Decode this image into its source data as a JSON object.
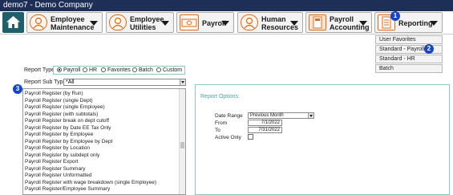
{
  "window": {
    "title": "demo7 - Demo Company"
  },
  "toolbar": {
    "home_icon": "home-icon",
    "buttons": [
      {
        "line1": "Employee",
        "line2": "Maintenance",
        "icon": "employee-icon"
      },
      {
        "line1": "Employee",
        "line2": "Utilities",
        "icon": "employee-utilities-icon"
      },
      {
        "line1": "Payroll",
        "line2": "",
        "icon": "payroll-money-icon"
      },
      {
        "line1": "Human",
        "line2": "Resources",
        "icon": "human-resources-icon"
      },
      {
        "line1": "Payroll",
        "line2": "Accounting",
        "icon": "calculator-icon"
      },
      {
        "line1": "Reporting",
        "line2": "",
        "icon": "reporting-icon"
      }
    ]
  },
  "reporting_menu": {
    "items": [
      "User Favorites",
      "Standard - Payroll",
      "Standard - HR",
      "Batch"
    ]
  },
  "badges": {
    "b1": "1",
    "b2": "2",
    "b3": "3"
  },
  "report_type": {
    "label": "Report Type",
    "options": [
      "Payroll",
      "HR",
      "Favorites",
      "Batch",
      "Custom"
    ],
    "selected": "Payroll"
  },
  "report_sub_type": {
    "label": "Report Sub Type",
    "value": "*All"
  },
  "report_list": [
    "Payroll Register (by Run)",
    "Payroll Register (single Dept)",
    "Payroll Register (single Employee)",
    "Payroll Register (with subtotals)",
    "Payroll Register break on dept cutoff",
    "Payroll Register by Date EE Tax Only",
    "Payroll Register by Employee",
    "Payroll Register by Employee by Dept",
    "Payroll Register by Location",
    "Payroll Register by subdept only",
    "Payroll Register Export",
    "Payroll Register Summary",
    "Payroll Register Unformatted",
    "Payroll Register with wage breakdown (single Employee)",
    "Payroll Register/Employee Summary"
  ],
  "report_options": {
    "title": "Report Options:",
    "date_range_label": "Date Range",
    "date_range_value": "Previous Month",
    "from_label": "From",
    "from_value": "7/1/2022",
    "to_label": "To",
    "to_value": "7/31/2022",
    "active_only_label": "Active Only"
  },
  "colors": {
    "title_bar": "#1e2f57",
    "badge": "#1546c4",
    "accent_teal": "#1f5f6b",
    "icon_orange": "#e06a1a"
  }
}
